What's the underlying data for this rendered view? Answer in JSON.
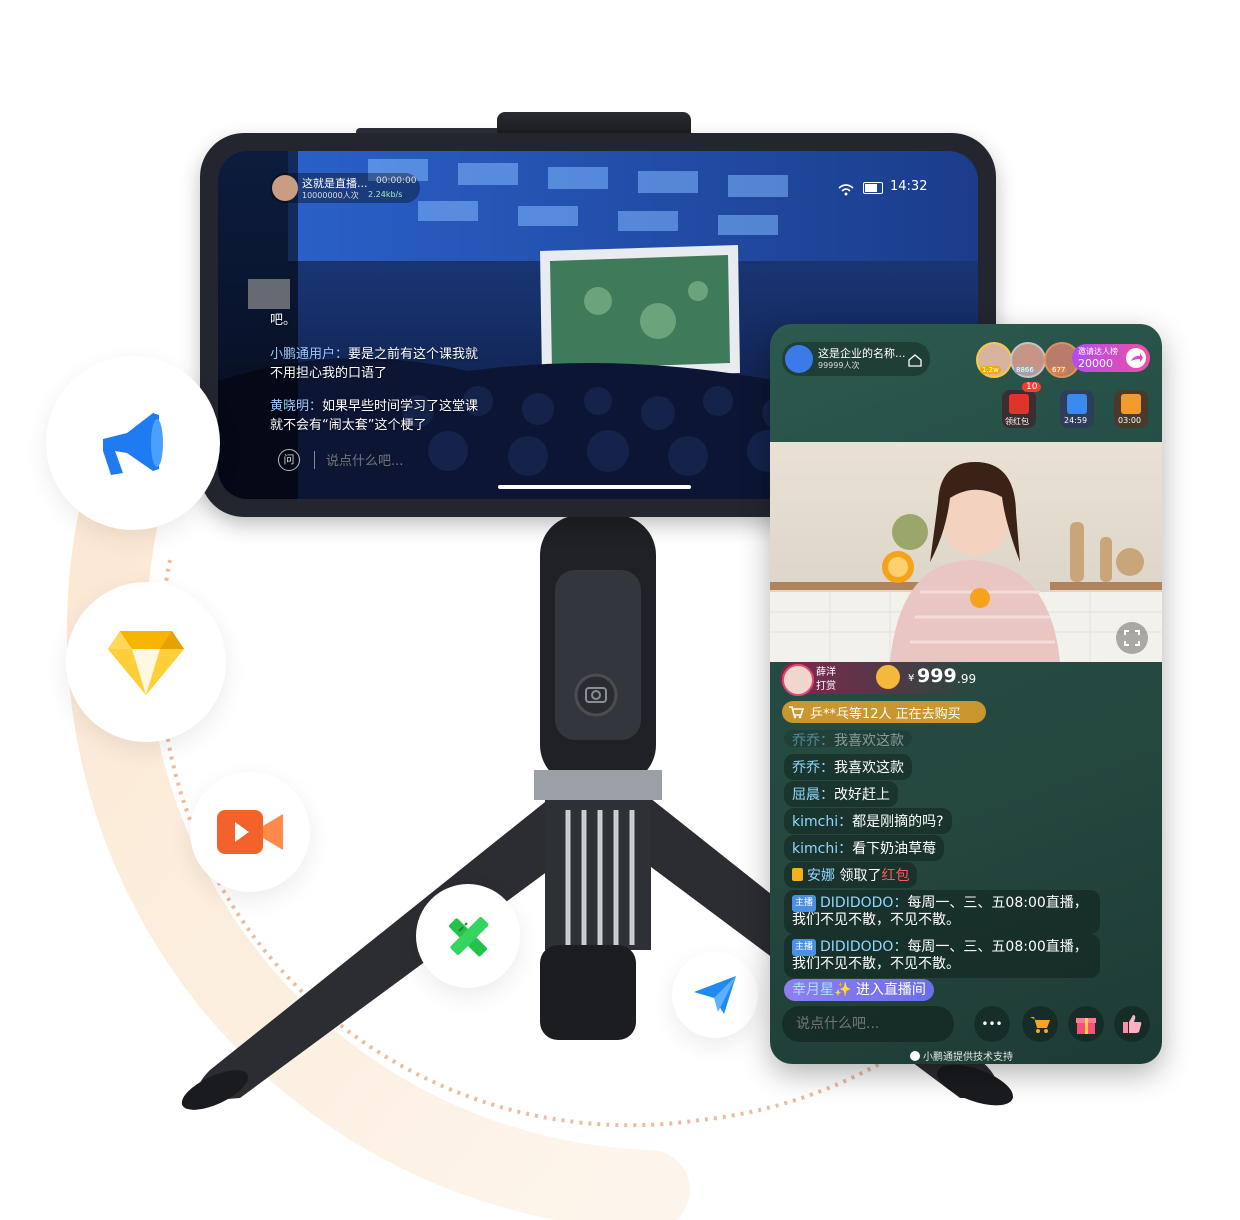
{
  "landscape_phone": {
    "host_title": "这就是直播...",
    "timer": "00:00:00",
    "viewers": "10000000人次",
    "speed": "2.24kb/s",
    "clock": "14:32",
    "comments": [
      {
        "text": "吧。"
      },
      {
        "name": "小鹏通用户：",
        "text": "要是之前有这个课我就不用担心我的口语了"
      },
      {
        "name": "黄晓明：",
        "text": "如果早些时间学习了这堂课就不会有“闹太套”这个梗了"
      }
    ],
    "ask_label": "问",
    "input_placeholder": "说点什么吧..."
  },
  "portrait_phone": {
    "org_name": "这是企业的名称...",
    "org_viewers": "99999人次",
    "rank_badges": [
      "1.2w",
      "8866",
      "677"
    ],
    "invite": {
      "label": "邀请达人榜",
      "value": "20000"
    },
    "tools": [
      {
        "icon": "red-envelope-icon",
        "label": "领红包",
        "badge": "10"
      },
      {
        "icon": "calendar-icon",
        "label": "24:59"
      },
      {
        "icon": "gift-box-icon",
        "label": "03:00"
      }
    ],
    "tip": {
      "name": "薛洋",
      "action": "打赏",
      "currency": "¥",
      "amount_int": "999",
      "amount_dec": ".99"
    },
    "buying": "乒**乓等12人 正在去购买",
    "messages": [
      {
        "name": "乔乔",
        "sep": "：",
        "text": "我喜欢这款",
        "faded": true
      },
      {
        "name": "乔乔",
        "sep": "：",
        "text": "我喜欢这款"
      },
      {
        "name": "屈晨",
        "sep": "：",
        "text": "改好赶上"
      },
      {
        "name": "kimchi",
        "sep": "：",
        "text": "都是刚摘的吗?"
      },
      {
        "name": "kimchi",
        "sep": "：",
        "text": "看下奶油草莓"
      }
    ],
    "redpack": {
      "name": "安娜",
      "text": "领取了",
      "highlight": "红包"
    },
    "anchor_messages": [
      {
        "tag": "主播",
        "name": "DIDIDODO",
        "sep": "：",
        "text": "每周一、三、五08:00直播，我们不见不散，不见不散。"
      },
      {
        "tag": "主播",
        "name": "DIDIDODO",
        "sep": "：",
        "text": "每周一、三、五08:00直播，我们不见不散，不见不散。"
      }
    ],
    "enter": {
      "name": "幸月星✨",
      "text": "进入直播间"
    },
    "input_placeholder": "说点什么吧...",
    "more_label": "•••",
    "footer": "小鹏通提供技术支持"
  },
  "features": [
    {
      "icon": "megaphone-icon",
      "color": "#1f7bf2"
    },
    {
      "icon": "diamond-icon",
      "color": "#f7b500"
    },
    {
      "icon": "video-camera-icon",
      "color": "#f2622a"
    },
    {
      "icon": "pencil-ruler-icon",
      "color": "#22c24b"
    },
    {
      "icon": "paper-plane-icon",
      "color": "#1f8bf2"
    }
  ]
}
